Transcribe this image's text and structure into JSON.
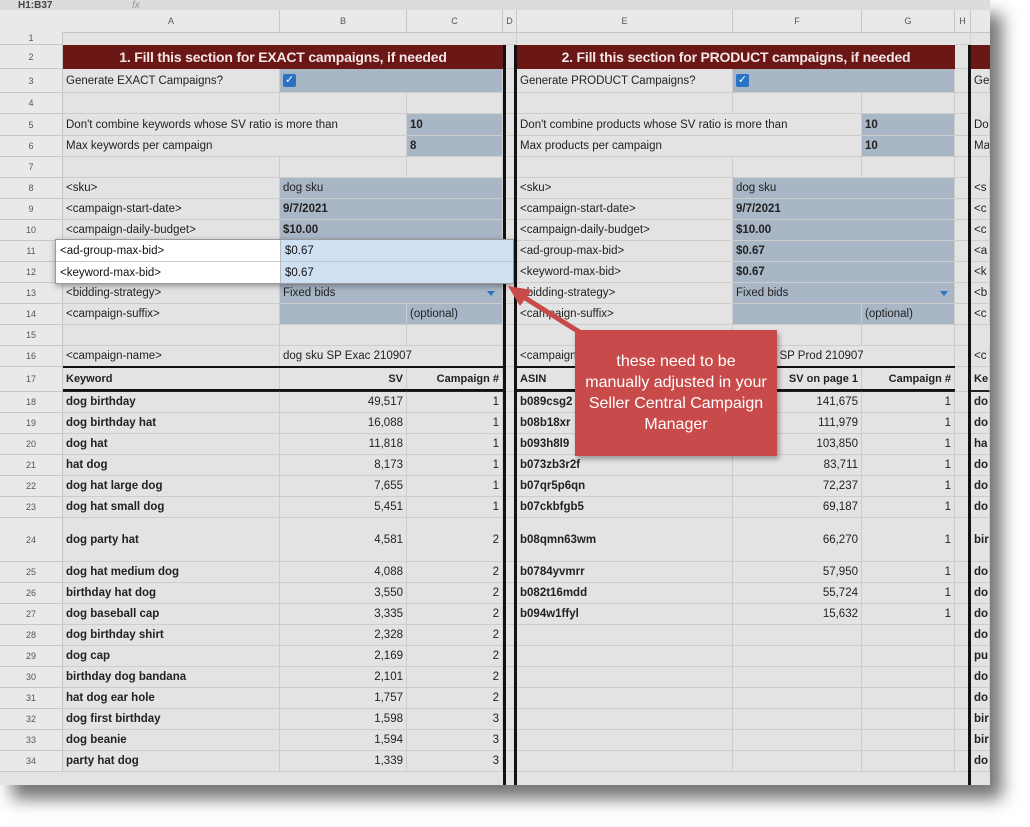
{
  "toolbar": {
    "cell_ref": "H1:B37",
    "fx": "fx"
  },
  "columns": [
    "A",
    "B",
    "C",
    "D",
    "E",
    "F",
    "G",
    "H"
  ],
  "rows": [
    "1",
    "2",
    "3",
    "4",
    "5",
    "6",
    "7",
    "8",
    "9",
    "10",
    "11",
    "12",
    "13",
    "14",
    "15",
    "16",
    "17",
    "18",
    "19",
    "20",
    "21",
    "22",
    "23",
    "24",
    "25",
    "26",
    "27",
    "28",
    "29",
    "30",
    "31",
    "32",
    "33",
    "34"
  ],
  "exact": {
    "header": "1. Fill this section for EXACT campaigns, if needed",
    "generate_label": "Generate EXACT Campaigns?",
    "generate_checked": true,
    "sv_ratio_label": "Don't combine keywords whose SV ratio is more than",
    "sv_ratio_value": "10",
    "max_label": "Max keywords per campaign",
    "max_value": "8",
    "sku_label": "<sku>",
    "sku_value": "dog sku",
    "start_label": "<campaign-start-date>",
    "start_value": "9/7/2021",
    "budget_label": "<campaign-daily-budget>",
    "budget_value": "$10.00",
    "adgroup_label": "<ad-group-max-bid>",
    "adgroup_value": "$0.67",
    "kwbid_label": "<keyword-max-bid>",
    "kwbid_value": "$0.67",
    "bidding_label": "<bidding-strategy>",
    "bidding_value": "Fixed bids",
    "suffix_label": "<campaign-suffix>",
    "suffix_optional": "(optional)",
    "name_label": "<campaign-name>",
    "name_value": "dog sku SP Exac 210907",
    "table_headers": [
      "Keyword",
      "SV",
      "Campaign #"
    ],
    "rows": [
      [
        "dog birthday",
        "49,517",
        "1"
      ],
      [
        "dog birthday hat",
        "16,088",
        "1"
      ],
      [
        "dog hat",
        "11,818",
        "1"
      ],
      [
        "hat dog",
        "8,173",
        "1"
      ],
      [
        "dog hat large dog",
        "7,655",
        "1"
      ],
      [
        "dog hat small dog",
        "5,451",
        "1"
      ],
      [
        "dog party hat",
        "4,581",
        "2"
      ],
      [
        "dog hat medium dog",
        "4,088",
        "2"
      ],
      [
        "birthday hat dog",
        "3,550",
        "2"
      ],
      [
        "dog baseball cap",
        "3,335",
        "2"
      ],
      [
        "dog birthday shirt",
        "2,328",
        "2"
      ],
      [
        "dog cap",
        "2,169",
        "2"
      ],
      [
        "birthday dog bandana",
        "2,101",
        "2"
      ],
      [
        "hat dog ear hole",
        "1,757",
        "2"
      ],
      [
        "dog first birthday",
        "1,598",
        "3"
      ],
      [
        "dog beanie",
        "1,594",
        "3"
      ],
      [
        "party hat dog",
        "1,339",
        "3"
      ]
    ]
  },
  "product": {
    "header": "2. Fill this section for PRODUCT campaigns, if needed",
    "generate_label": "Generate PRODUCT Campaigns?",
    "generate_checked": true,
    "sv_ratio_label": "Don't combine products whose SV ratio is more than",
    "sv_ratio_value": "10",
    "max_label": "Max products per campaign",
    "max_value": "10",
    "sku_label": "<sku>",
    "sku_value": "dog sku",
    "start_label": "<campaign-start-date>",
    "start_value": "9/7/2021",
    "budget_label": "<campaign-daily-budget>",
    "budget_value": "$10.00",
    "adgroup_label": "<ad-group-max-bid>",
    "adgroup_value": "$0.67",
    "kwbid_label": "<keyword-max-bid>",
    "kwbid_value": "$0.67",
    "bidding_label": "<bidding-strategy>",
    "bidding_value": "Fixed bids",
    "suffix_label": "<campaign-suffix>",
    "suffix_optional": "(optional)",
    "name_label": "<campaign-name>",
    "name_value": "dog sku SP Prod 210907",
    "table_headers": [
      "ASIN",
      "SV on page 1",
      "Campaign #"
    ],
    "rows": [
      [
        "b089csg2",
        "141,675",
        "1"
      ],
      [
        "b08b18xr",
        "111,979",
        "1"
      ],
      [
        "b093h8l9",
        "103,850",
        "1"
      ],
      [
        "b073zb3r2f",
        "83,711",
        "1"
      ],
      [
        "b07qr5p6qn",
        "72,237",
        "1"
      ],
      [
        "b07ckbfgb5",
        "69,187",
        "1"
      ],
      [
        "b08qmn63wm",
        "66,270",
        "1"
      ],
      [
        "b0784yvmrr",
        "57,950",
        "1"
      ],
      [
        "b082t16mdd",
        "55,724",
        "1"
      ],
      [
        "b094w1ffyl",
        "15,632",
        "1"
      ]
    ]
  },
  "third": {
    "header_fragments": [
      "Ge",
      "Do",
      "Ma",
      "<s",
      "<c",
      "<c",
      "<a",
      "<k",
      "<b",
      "<c",
      "<c",
      "Ke"
    ],
    "rows": [
      "do",
      "do",
      "ha",
      "do",
      "do",
      "do",
      "bir",
      "do",
      "do",
      "do",
      "do",
      "pu",
      "do",
      "do",
      "bir",
      "bir",
      "do"
    ]
  },
  "callout": {
    "text": "these need to be manually adjusted in your Seller Central Campaign Manager"
  },
  "colors": {
    "header_bg": "#6b1716",
    "input_bg": "#a9b6c6",
    "callout_bg": "#c94a4a",
    "check": "#2a72c4"
  }
}
